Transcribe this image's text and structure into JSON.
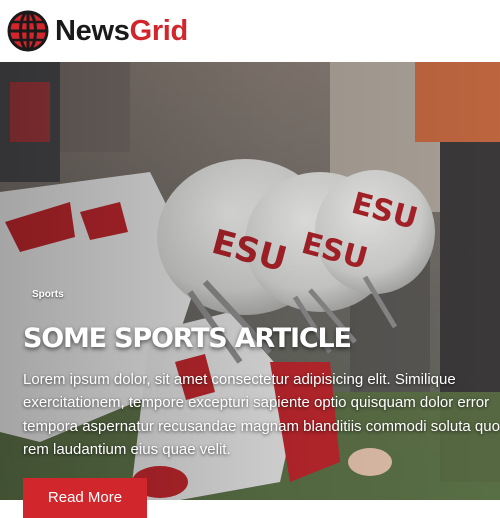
{
  "header": {
    "logo": {
      "icon": "globe-icon",
      "word_dark": "News",
      "word_accent": "Grid"
    }
  },
  "hero": {
    "category": "Sports",
    "title": "SOME SPORTS ARTICLE",
    "excerpt_lines": [
      "Lorem ipsum dolor, sit amet consectetur adipisicing elit. Similique",
      "exercitationem, tempore excepturi sapiente optio quisquam dolor error",
      "tempora aspernatur recusandae magnam blanditiis commodi soluta quo",
      "rem laudantium eius quae velit."
    ],
    "button_label": "Read More"
  },
  "colors": {
    "accent": "#d0262c",
    "text_dark": "#1a1a1a",
    "on_image": "#ffffff"
  }
}
